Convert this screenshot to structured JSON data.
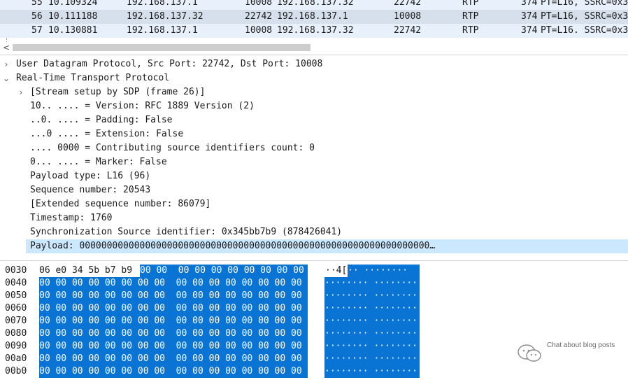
{
  "packets": [
    {
      "no": "55",
      "time": "10.109324",
      "src": "192.168.137.1",
      "sport": "10008",
      "dst": "192.168.137.32",
      "dport": "22742",
      "proto": "RTP",
      "len": "374",
      "info": "PT=L16, SSRC=0x3",
      "selected": false
    },
    {
      "no": "56",
      "time": "10.111188",
      "src": "192.168.137.32",
      "sport": "22742",
      "dst": "192.168.137.1",
      "dport": "10008",
      "proto": "RTP",
      "len": "374",
      "info": "PT=L16, SSRC=0x3",
      "selected": true
    },
    {
      "no": "57",
      "time": "10.130881",
      "src": "192.168.137.1",
      "sport": "10008",
      "dst": "192.168.137.32",
      "dport": "22742",
      "proto": "RTP",
      "len": "374",
      "info": "PT=L16. SSRC=0x3",
      "selected": false
    }
  ],
  "scrollbar": {
    "left_arrow": "<"
  },
  "details": {
    "udp": "User Datagram Protocol, Src Port: 22742, Dst Port: 10008",
    "rtp": "Real-Time Transport Protocol",
    "fields": [
      {
        "text": "[Stream setup by SDP (frame 26)]",
        "expandable": true
      },
      {
        "text": "10.. .... = Version: RFC 1889 Version (2)",
        "expandable": false
      },
      {
        "text": "..0. .... = Padding: False",
        "expandable": false
      },
      {
        "text": "...0 .... = Extension: False",
        "expandable": false
      },
      {
        "text": ".... 0000 = Contributing source identifiers count: 0",
        "expandable": false
      },
      {
        "text": "0... .... = Marker: False",
        "expandable": false
      },
      {
        "text": "Payload type: L16 (96)",
        "expandable": false
      },
      {
        "text": "Sequence number: 20543",
        "expandable": false
      },
      {
        "text": "[Extended sequence number: 86079]",
        "expandable": false
      },
      {
        "text": "Timestamp: 1760",
        "expandable": false
      },
      {
        "text": "Synchronization Source identifier: 0x345bb7b9 (878426041)",
        "expandable": false
      },
      {
        "text": "Payload: 0000000000000000000000000000000000000000000000000000000000000000…",
        "expandable": false,
        "selected": true
      }
    ]
  },
  "hex": {
    "rows": [
      {
        "offset": "0030",
        "plain": "06 e0 34 5b b7 b9",
        "hl": "00 00  00 00 00 00 00 00 00 00",
        "ascii_plain": "··4[",
        "ascii_hl": "·· ········"
      },
      {
        "offset": "0040",
        "plain": "",
        "hl": "00 00 00 00 00 00 00 00  00 00 00 00 00 00 00 00",
        "ascii_plain": "",
        "ascii_hl": "········ ········"
      },
      {
        "offset": "0050",
        "plain": "",
        "hl": "00 00 00 00 00 00 00 00  00 00 00 00 00 00 00 00",
        "ascii_plain": "",
        "ascii_hl": "········ ········"
      },
      {
        "offset": "0060",
        "plain": "",
        "hl": "00 00 00 00 00 00 00 00  00 00 00 00 00 00 00 00",
        "ascii_plain": "",
        "ascii_hl": "········ ········"
      },
      {
        "offset": "0070",
        "plain": "",
        "hl": "00 00 00 00 00 00 00 00  00 00 00 00 00 00 00 00",
        "ascii_plain": "",
        "ascii_hl": "········ ········"
      },
      {
        "offset": "0080",
        "plain": "",
        "hl": "00 00 00 00 00 00 00 00  00 00 00 00 00 00 00 00",
        "ascii_plain": "",
        "ascii_hl": "········ ········"
      },
      {
        "offset": "0090",
        "plain": "",
        "hl": "00 00 00 00 00 00 00 00  00 00 00 00 00 00 00 00",
        "ascii_plain": "",
        "ascii_hl": "········ ········"
      },
      {
        "offset": "00a0",
        "plain": "",
        "hl": "00 00 00 00 00 00 00 00  00 00 00 00 00 00 00 00",
        "ascii_plain": "",
        "ascii_hl": "········ ········"
      },
      {
        "offset": "00b0",
        "plain": "",
        "hl": "00 00 00 00 00 00 00 00  00 00 00 00 00 00 00 00",
        "ascii_plain": "",
        "ascii_hl": "········ ········"
      }
    ]
  },
  "watermark": {
    "text": "Chat about blog posts",
    "logo_icon": "wechat-logo"
  },
  "colors": {
    "selection": "#cce8ff",
    "hex_highlight": "#0a74d4"
  }
}
